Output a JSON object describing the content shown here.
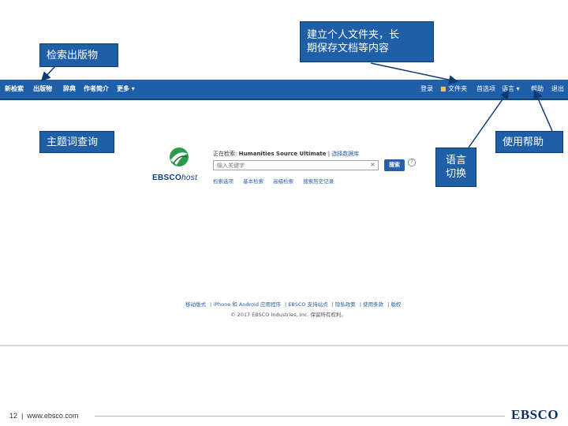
{
  "nav": {
    "new_search": "新检索",
    "publications": "出版物",
    "dictionary": "辞典",
    "author_profiles": "作者简介",
    "more": "更多 ▾",
    "sign_in": "登录",
    "folder": "文件夹",
    "preferences": "首选项",
    "language": "语言 ▾",
    "help": "帮助",
    "exit": "退出"
  },
  "search": {
    "searching_label": "正在检索: ",
    "database": "Humanities Source Ultimate",
    "choose_db": "选择数据库",
    "placeholder": "输入关键字",
    "button": "搜索",
    "help": "?",
    "clear": "×",
    "options": [
      "检索选项",
      "基本检索",
      "高级检索",
      "搜索历史记录"
    ]
  },
  "logo": {
    "ebsco": "EBSCO",
    "host": "host"
  },
  "footer": {
    "links": [
      "移动版式",
      "iPhone 和 Android 应用程序",
      "EBSCO 支持站点",
      "隐私政策",
      "使用条款",
      "版权"
    ],
    "copyright": "© 2017 EBSCO Industries, Inc. 保留所有权利。"
  },
  "callouts": {
    "publications": "检索出版物",
    "folder_line1": "建立个人文件夹，长",
    "folder_line2": "期保存文档等内容",
    "subject": "主题词查询",
    "help": "使用帮助",
    "language_line1": "语言",
    "language_line2": "切换"
  },
  "slide": {
    "page_number": "12",
    "url": "www.ebsco.com",
    "brand": "EBSCO"
  },
  "colors": {
    "nav_bg": "#1f5fa8",
    "callout_bg": "#1f5fa8",
    "link": "#2a5ea6",
    "logo": "#0b3d7e"
  }
}
